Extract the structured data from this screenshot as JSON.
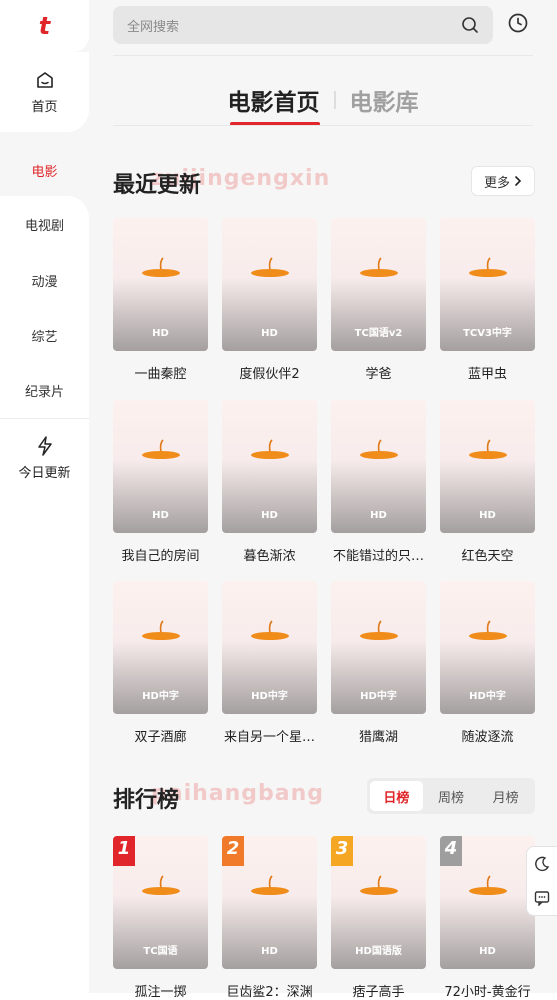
{
  "sidebar": {
    "logo_text": "t",
    "home_label": "首页",
    "categories": [
      "电影",
      "电视剧",
      "动漫",
      "综艺",
      "纪录片"
    ],
    "today_label": "今日更新"
  },
  "search": {
    "placeholder": "全网搜索"
  },
  "tabs": {
    "active": "电影首页",
    "inactive": "电影库"
  },
  "recent": {
    "title": "最近更新",
    "ghost": "zuijingengxin",
    "more_label": "更多",
    "items": [
      {
        "title": "一曲秦腔",
        "badge": "HD"
      },
      {
        "title": "度假伙伴2",
        "badge": "HD"
      },
      {
        "title": "学爸",
        "badge": "TC国语v2"
      },
      {
        "title": "蓝甲虫",
        "badge": "TCV3中字"
      },
      {
        "title": "我自己的房间",
        "badge": "HD"
      },
      {
        "title": "暮色渐浓",
        "badge": "HD"
      },
      {
        "title": "不能错过的只…",
        "badge": "HD"
      },
      {
        "title": "红色天空",
        "badge": "HD"
      },
      {
        "title": "双子酒廊",
        "badge": "HD中字"
      },
      {
        "title": "来自另一个星…",
        "badge": "HD中字"
      },
      {
        "title": "猎鹰湖",
        "badge": "HD中字"
      },
      {
        "title": "随波逐流",
        "badge": "HD中字"
      }
    ]
  },
  "ranking": {
    "title": "排行榜",
    "ghost": "paihangbang",
    "tabs": [
      "日榜",
      "周榜",
      "月榜"
    ],
    "items": [
      {
        "rank": "1",
        "title": "孤注一掷",
        "badge": "TC国语",
        "color": "#e0262a"
      },
      {
        "rank": "2",
        "title": "巨齿鲨2：深渊",
        "badge": "HD",
        "color": "#f07a2a"
      },
      {
        "rank": "3",
        "title": "痞子高手",
        "badge": "HD国语版",
        "color": "#f5a623"
      },
      {
        "rank": "4",
        "title": "72小时-黄金行",
        "badge": "HD",
        "color": "#9e9e9e"
      }
    ]
  },
  "colors": {
    "accent": "#e0262a"
  }
}
